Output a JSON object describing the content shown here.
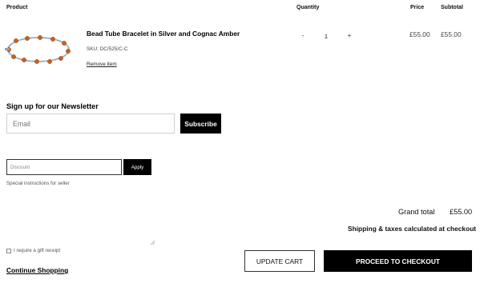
{
  "table_header": {
    "product": "Product",
    "quantity": "Quantity",
    "price": "Price",
    "subtotal": "Subtotal"
  },
  "cart_item": {
    "title": "Bead Tube Bracelet in Silver and Cognac Amber",
    "sku": "SKU: DC/525/C-C",
    "remove_label": "Remove item",
    "qty_minus": "-",
    "quantity": "1",
    "qty_plus": "+",
    "price": "£55.00",
    "subtotal": "£55.00"
  },
  "newsletter": {
    "heading": "Sign up for our Newsletter",
    "email_placeholder": "Email",
    "subscribe_label": "Subscribe"
  },
  "discount": {
    "placeholder": "Discount",
    "apply_label": "Apply"
  },
  "instructions": {
    "label": "Special instructions for seller"
  },
  "gift": {
    "label": "I require a gift receipt",
    "checked": false
  },
  "links": {
    "continue_shopping": "Continue Shopping"
  },
  "totals": {
    "grand_total_label": "Grand total",
    "grand_total_value": "£55.00",
    "shipping_note": "Shipping & taxes calculated at checkout"
  },
  "actions": {
    "update_cart": "UPDATE CART",
    "checkout": "PROCEED TO CHECKOUT"
  },
  "colors": {
    "accent": "#000000",
    "silver": "#b8bcc2",
    "amber": "#c8621a"
  }
}
